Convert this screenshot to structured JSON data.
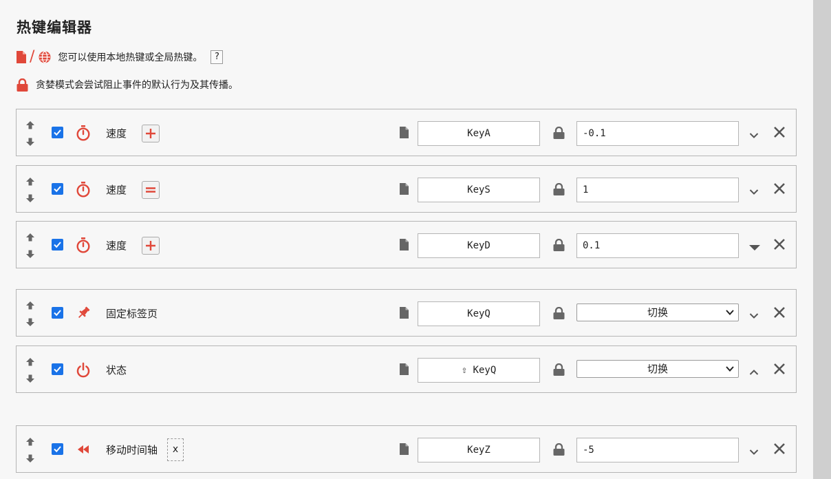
{
  "title": "热键编辑器",
  "info_line1": "您可以使用本地热键或全局热键。",
  "info_help": "?",
  "info_line2": "贪婪模式会尝试阻止事件的默认行为及其传播。",
  "colors": {
    "accent": "#e0483a",
    "checkbox": "#1a73e8"
  },
  "rows": [
    {
      "icon": "stopwatch-icon",
      "label": "速度",
      "op": "plus",
      "key": "KeyA",
      "value": "-0.1",
      "value_type": "input",
      "chevron": "down",
      "enabled": true
    },
    {
      "icon": "stopwatch-icon",
      "label": "速度",
      "op": "equals",
      "key": "KeyS",
      "value": "1",
      "value_type": "input",
      "chevron": "down",
      "enabled": true
    },
    {
      "icon": "stopwatch-icon",
      "label": "速度",
      "op": "plus",
      "key": "KeyD",
      "value": "0.1",
      "value_type": "input",
      "chevron": "caret-down",
      "enabled": true
    },
    {
      "icon": "pin-icon",
      "label": "固定标签页",
      "key": "KeyQ",
      "value": "切换",
      "value_type": "select",
      "chevron": "down",
      "enabled": true
    },
    {
      "icon": "power-icon",
      "label": "状态",
      "key": "⇧ KeyQ",
      "value": "切换",
      "value_type": "select",
      "chevron": "up",
      "enabled": true
    },
    {
      "icon": "rewind-icon",
      "label": "移动时间轴",
      "extra": "x",
      "key": "KeyZ",
      "value": "-5",
      "value_type": "input",
      "chevron": "down",
      "enabled": true
    }
  ]
}
